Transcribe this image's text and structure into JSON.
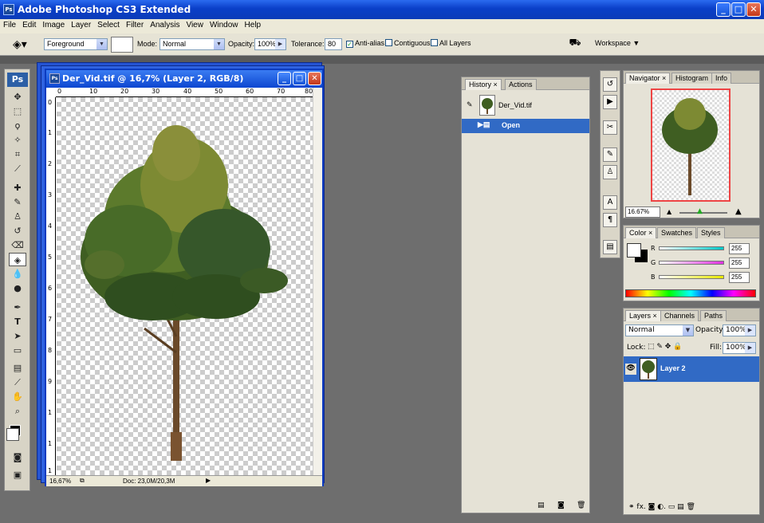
{
  "app": {
    "title": "Adobe Photoshop CS3 Extended",
    "icon_text": "Ps"
  },
  "menu": [
    "File",
    "Edit",
    "Image",
    "Layer",
    "Select",
    "Filter",
    "Analysis",
    "View",
    "Window",
    "Help"
  ],
  "options_bar": {
    "fill_source": "Foreground",
    "mode_label": "Mode:",
    "mode_value": "Normal",
    "opacity_label": "Opacity:",
    "opacity_value": "100%",
    "tolerance_label": "Tolerance:",
    "tolerance_value": "80",
    "antialias_label": "Anti-alias",
    "antialias_checked": true,
    "contiguous_label": "Contiguous",
    "all_layers_label": "All Layers",
    "workspace_label": "Workspace"
  },
  "toolbox": {
    "logo": "Ps",
    "tools": [
      "move-icon",
      "marquee-icon",
      "lasso-icon",
      "magic-wand-icon",
      "crop-icon",
      "slice-icon",
      "healing-brush-icon",
      "brush-icon",
      "clone-stamp-icon",
      "history-brush-icon",
      "eraser-icon",
      "paint-bucket-icon",
      "blur-icon",
      "dodge-icon",
      "pen-icon",
      "type-icon",
      "path-selection-icon",
      "rectangle-icon",
      "notes-icon",
      "eyedropper-icon",
      "hand-icon",
      "zoom-icon"
    ],
    "active_tool": "paint-bucket-icon"
  },
  "document": {
    "title": "Der_Vid.tif @ 16,7% (Layer 2, RGB/8)",
    "icon_text": "Ps",
    "ruler_h": [
      "0",
      "10",
      "20",
      "30",
      "40",
      "50",
      "60",
      "70",
      "80"
    ],
    "ruler_v": [
      "0",
      "1",
      "2",
      "3",
      "4",
      "5",
      "6",
      "7",
      "8",
      "9",
      "1",
      "1",
      "1"
    ],
    "zoom": "16,67%",
    "doc_info": "Doc: 23,0M/20,3M"
  },
  "history": {
    "tabs": [
      "History",
      "Actions"
    ],
    "snapshot_name": "Der_Vid.tif",
    "states": [
      "Open"
    ]
  },
  "navigator": {
    "tabs": [
      "Navigator",
      "Histogram",
      "Info"
    ],
    "zoom": "16.67%"
  },
  "color": {
    "tabs": [
      "Color",
      "Swatches",
      "Styles"
    ],
    "channels": [
      {
        "label": "R",
        "value": "255",
        "color": "#00c8c8"
      },
      {
        "label": "G",
        "value": "255",
        "color": "#e030e0"
      },
      {
        "label": "B",
        "value": "255",
        "color": "#e8e800"
      }
    ]
  },
  "layers": {
    "tabs": [
      "Layers",
      "Channels",
      "Paths"
    ],
    "blend_mode": "Normal",
    "opacity_label": "Opacity:",
    "opacity_value": "100%",
    "lock_label": "Lock:",
    "fill_label": "Fill:",
    "fill_value": "100%",
    "items": [
      {
        "name": "Layer 2",
        "visible": true
      }
    ]
  },
  "colors": {
    "selection_blue": "#316ac5",
    "titlebar_blue": "#0b3bc0",
    "workspace_gray": "#6e6e6e"
  }
}
